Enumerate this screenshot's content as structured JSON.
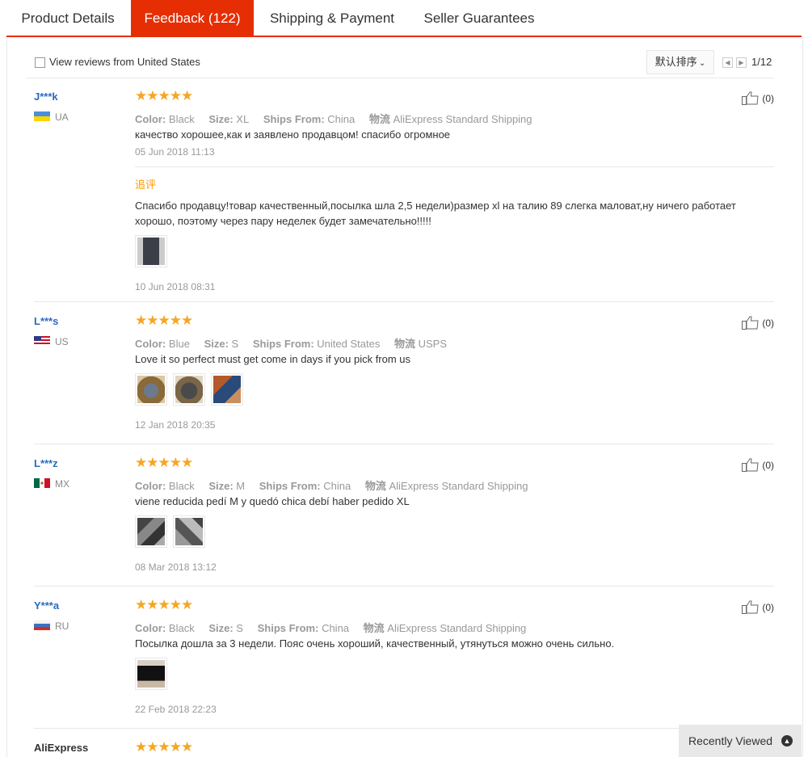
{
  "tabs": [
    {
      "label": "Product Details"
    },
    {
      "label": "Feedback (122)"
    },
    {
      "label": "Shipping & Payment"
    },
    {
      "label": "Seller Guarantees"
    }
  ],
  "toolbar": {
    "filter_label": "View reviews from United States",
    "sort_label": "默认排序",
    "page_indicator": "1/12"
  },
  "reviews": [
    {
      "user": "J***k",
      "country": "UA",
      "rating": 5,
      "color_label": "Color:",
      "color": "Black",
      "size_label": "Size:",
      "size": "XL",
      "ships_label": "Ships From:",
      "ships": "China",
      "logistics_label": "物流",
      "logistics": "AliExpress Standard Shipping",
      "text": "качество хорошее,как и заявлено продавцом! спасибо огромное",
      "date": "05 Jun 2018 11:13",
      "likes": "(0)",
      "additional_label": "追评",
      "additional_text": "Спасибо продавцу!товар качественный,посылка шла 2,5 недели)размер xl на талию 89 слегка маловат,ну ничего работает хорошо, поэтому через пару неделек будет замечательно!!!!!",
      "additional_date": "10 Jun 2018 08:31"
    },
    {
      "user": "L***s",
      "country": "US",
      "rating": 5,
      "color_label": "Color:",
      "color": "Blue",
      "size_label": "Size:",
      "size": "S",
      "ships_label": "Ships From:",
      "ships": "United States",
      "logistics_label": "物流",
      "logistics": "USPS",
      "text": "Love it so perfect must get come in days if you pick from us",
      "date": "12 Jan 2018 20:35",
      "likes": "(0)"
    },
    {
      "user": "L***z",
      "country": "MX",
      "rating": 5,
      "color_label": "Color:",
      "color": "Black",
      "size_label": "Size:",
      "size": "M",
      "ships_label": "Ships From:",
      "ships": "China",
      "logistics_label": "物流",
      "logistics": "AliExpress Standard Shipping",
      "text": "viene reducida pedí M y quedó chica debí haber pedido XL",
      "date": "08 Mar 2018 13:12",
      "likes": "(0)"
    },
    {
      "user": "Y***a",
      "country": "RU",
      "rating": 5,
      "color_label": "Color:",
      "color": "Black",
      "size_label": "Size:",
      "size": "S",
      "ships_label": "Ships From:",
      "ships": "China",
      "logistics_label": "物流",
      "logistics": "AliExpress Standard Shipping",
      "text": "Посылка дошла за 3 недели. Пояс очень хороший, качественный, утянуться можно очень сильно.",
      "date": "22 Feb 2018 22:23",
      "likes": "(0)"
    },
    {
      "user": "AliExpress",
      "rating": 5
    }
  ],
  "recently_viewed": {
    "label": "Recently Viewed"
  },
  "colors": {
    "accent": "#e62e04",
    "star": "#f5a623",
    "username": "#2a6bc0",
    "additional": "#ff9900"
  }
}
